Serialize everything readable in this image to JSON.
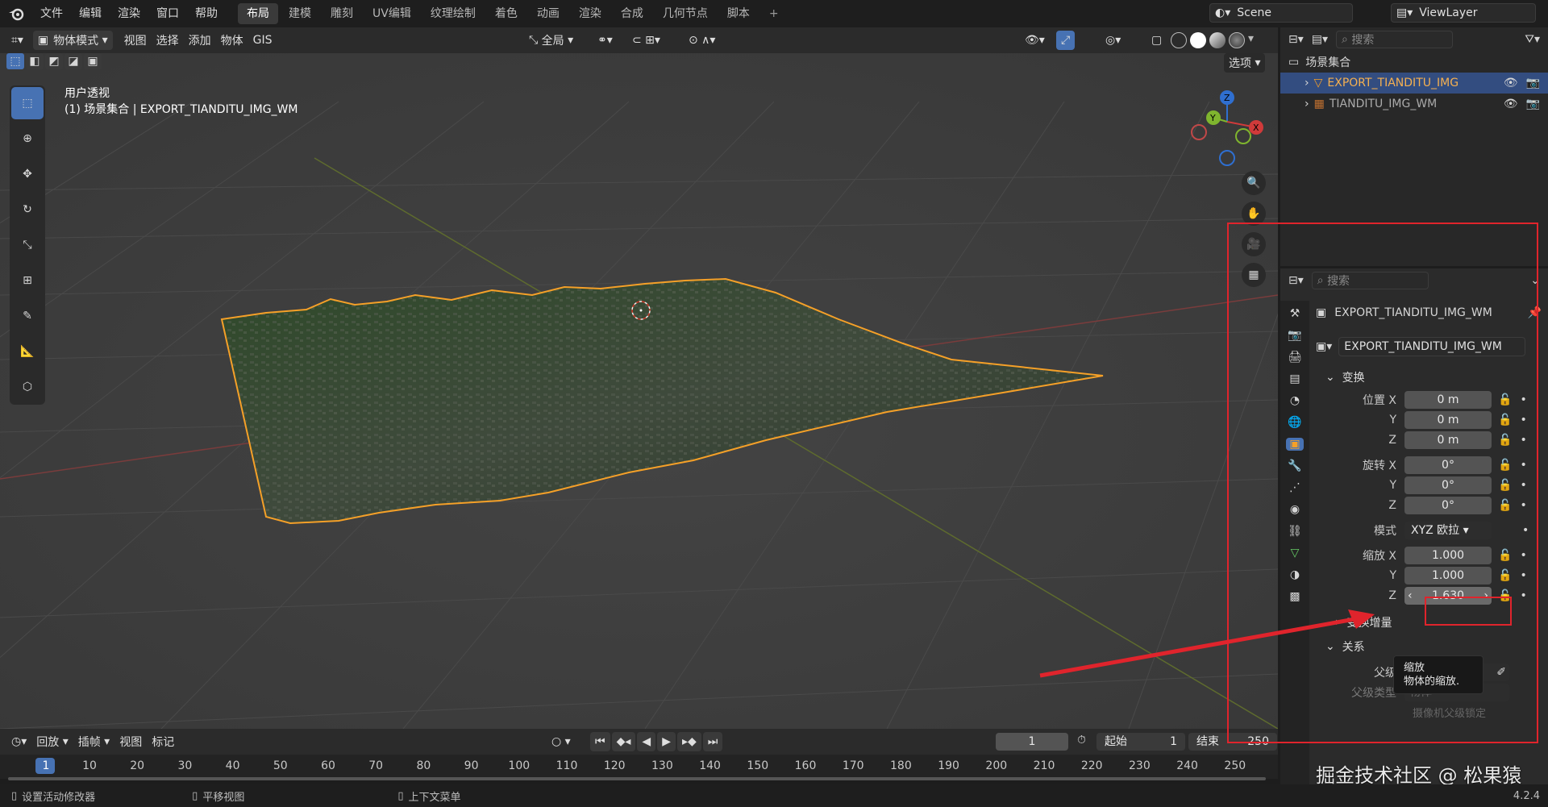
{
  "menu": [
    "文件",
    "编辑",
    "渲染",
    "窗口",
    "帮助"
  ],
  "workspaces": [
    "布局",
    "建模",
    "雕刻",
    "UV编辑",
    "纹理绘制",
    "着色",
    "动画",
    "渲染",
    "合成",
    "几何节点",
    "脚本"
  ],
  "scene_name": "Scene",
  "view_layer": "ViewLayer",
  "viewport_header": {
    "mode": "物体模式",
    "view": "视图",
    "select": "选择",
    "add": "添加",
    "object": "物体",
    "gis": "GIS",
    "transform_orient": "全局",
    "options": "选项"
  },
  "viewport": {
    "title": "用户透视",
    "subtitle": "(1) 场景集合 | EXPORT_TIANDITU_IMG_WM"
  },
  "outliner": {
    "search_placeholder": "搜索",
    "collection": "场景集合",
    "items": [
      {
        "name": "EXPORT_TIANDITU_IMG"
      },
      {
        "name": "TIANDITU_IMG_WM"
      }
    ]
  },
  "properties": {
    "search_placeholder": "搜索",
    "object_name": "EXPORT_TIANDITU_IMG_WM",
    "data_name": "EXPORT_TIANDITU_IMG_WM",
    "transform_section": "变换",
    "location_label": "位置 X",
    "loc": [
      "0 m",
      "0 m",
      "0 m"
    ],
    "rotation_label": "旋转 X",
    "rot": [
      "0°",
      "0°",
      "0°"
    ],
    "mode_label": "模式",
    "mode_value": "XYZ 欧拉",
    "scale_label": "缩放 X",
    "scale": [
      "1.000",
      "1.000",
      "1.630"
    ],
    "y": "Y",
    "z": "Z",
    "delta_section": "变换增量",
    "tooltip_title": "缩放",
    "tooltip_desc": "物体的缩放.",
    "relations_section": "关系",
    "parent_label": "父级",
    "parent_placeholder": "物体",
    "parent_type_label": "父级类型",
    "parent_type_value": "物体",
    "camera_parent_lock": "摄像机父级锁定"
  },
  "timeline": {
    "playback": "回放",
    "keying": "插帧",
    "view": "视图",
    "marker": "标记",
    "current_frame": "1",
    "start_label": "起始",
    "start": "1",
    "end_label": "结束",
    "end": "250",
    "ruler": [
      "1",
      "10",
      "20",
      "30",
      "40",
      "50",
      "60",
      "70",
      "80",
      "90",
      "100",
      "110",
      "120",
      "130",
      "140",
      "150",
      "160",
      "170",
      "180",
      "190",
      "200",
      "210",
      "220",
      "230",
      "240",
      "250"
    ]
  },
  "statusbar": {
    "left": "设置活动修改器",
    "mid": "平移视图",
    "right": "上下文菜单",
    "version": "4.2.4"
  },
  "watermark": "掘金技术社区 @ 松果猿",
  "colors": {
    "accent": "#4772b3",
    "selection_orange": "#f5a028",
    "annotation_red": "#e0242c"
  }
}
